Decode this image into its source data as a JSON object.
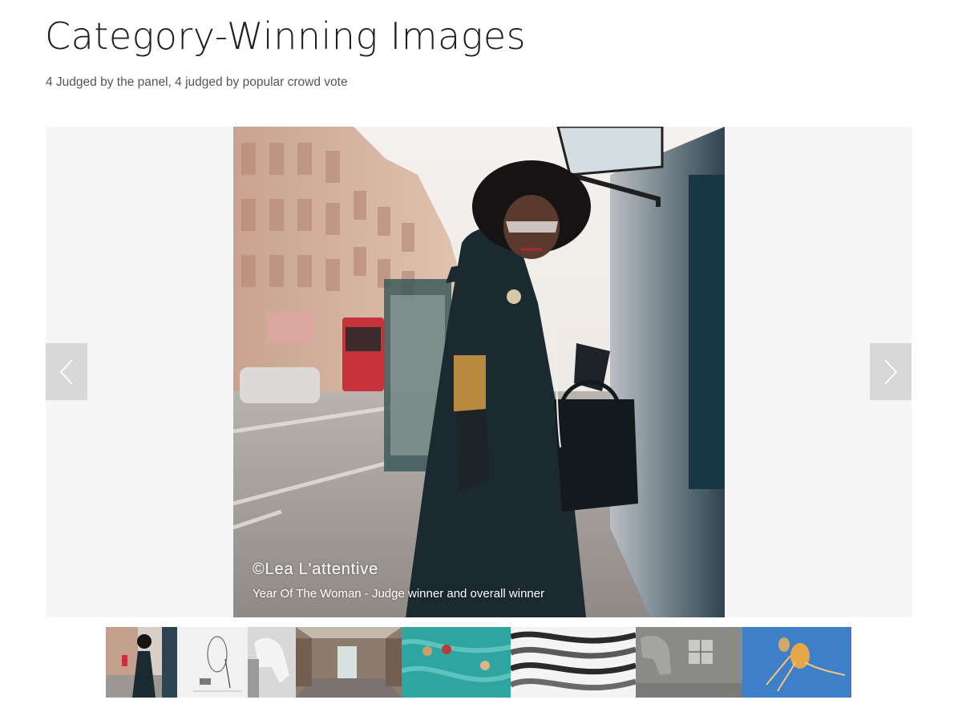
{
  "header": {
    "title": "Category-Winning Images",
    "subtitle": "4 Judged by the panel, 4 judged by popular crowd vote"
  },
  "slide": {
    "credit": "©Lea L'attentive",
    "description": "Year Of The Woman - Judge winner and overall winner"
  },
  "navigation": {
    "prev_icon": "chevron-left-icon",
    "next_icon": "chevron-right-icon"
  },
  "thumbnails": [
    {
      "subject": "woman in black cape on street",
      "selected": true
    },
    {
      "subject": "wire sculpture on white"
    },
    {
      "subject": "white horse"
    },
    {
      "subject": "empty wooden room"
    },
    {
      "subject": "figures on teal fabric"
    },
    {
      "subject": "abstract black and white waves"
    },
    {
      "subject": "horse by window in grey room"
    },
    {
      "subject": "jellyfish on blue"
    }
  ],
  "colors": {
    "gallery_background": "#f5f5f5",
    "nav_button": "#d8d8d8",
    "caption_text": "#ffffff"
  }
}
